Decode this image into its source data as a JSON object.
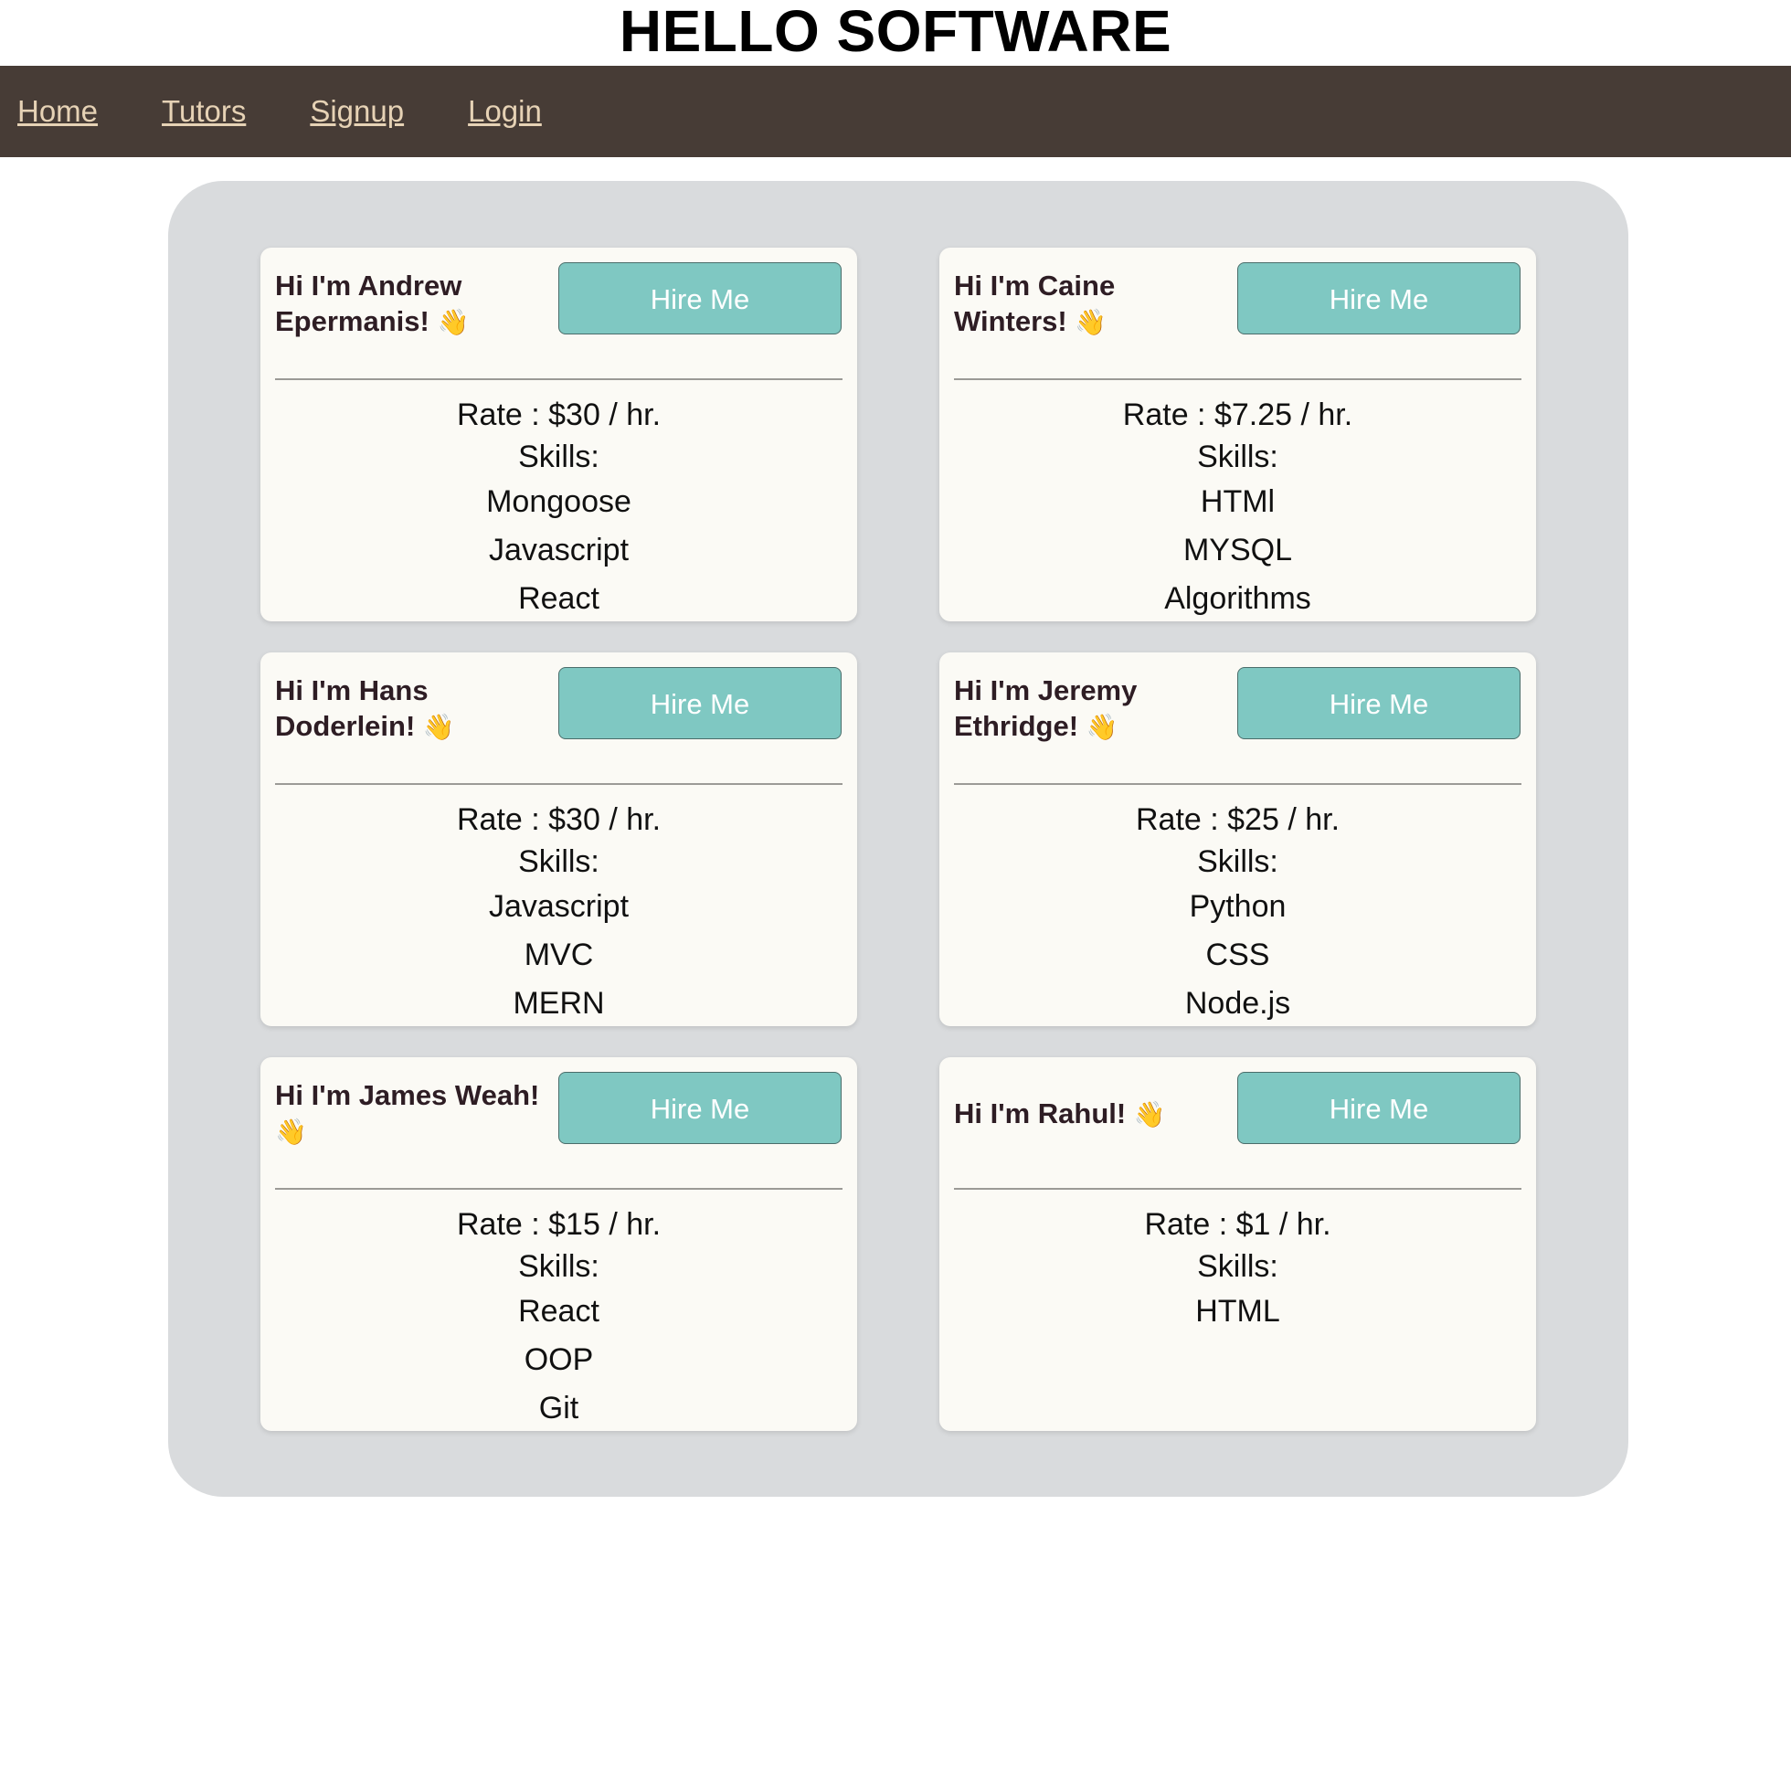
{
  "site": {
    "title": "HELLO SOFTWARE"
  },
  "nav": {
    "items": [
      {
        "label": "Home"
      },
      {
        "label": "Tutors"
      },
      {
        "label": "Signup"
      },
      {
        "label": "Login"
      }
    ]
  },
  "tutors": [
    {
      "name_line1": "Hi I'm Andrew",
      "name_line2": "Epermanis!",
      "wave": "👋",
      "button": "Hire Me",
      "rate": "Rate : $30 / hr.",
      "skills_label": "Skills:",
      "skills": [
        "Mongoose",
        "Javascript",
        "React"
      ]
    },
    {
      "name_line1": "Hi I'm Caine",
      "name_line2": "Winters!",
      "wave": "👋",
      "button": "Hire Me",
      "rate": "Rate : $7.25 / hr.",
      "skills_label": "Skills:",
      "skills": [
        "HTMl",
        "MYSQL",
        "Algorithms"
      ]
    },
    {
      "name_line1": "Hi I'm Hans",
      "name_line2": "Doderlein!",
      "wave": "👋",
      "button": "Hire Me",
      "rate": "Rate : $30 / hr.",
      "skills_label": "Skills:",
      "skills": [
        "Javascript",
        "MVC",
        "MERN"
      ]
    },
    {
      "name_line1": "Hi I'm Jeremy",
      "name_line2": "Ethridge!",
      "wave": "👋",
      "button": "Hire Me",
      "rate": "Rate : $25 / hr.",
      "skills_label": "Skills:",
      "skills": [
        "Python",
        "CSS",
        "Node.js"
      ]
    },
    {
      "name_line1": "Hi I'm James Weah!",
      "name_line2": "",
      "wave": "👋",
      "button": "Hire Me",
      "rate": "Rate : $15 / hr.",
      "skills_label": "Skills:",
      "skills": [
        "React",
        "OOP",
        "Git"
      ]
    },
    {
      "name_line1": "Hi I'm Rahul!",
      "name_line2": "",
      "wave": "👋",
      "button": "Hire Me",
      "rate": "Rate : $1 / hr.",
      "skills_label": "Skills:",
      "skills": [
        "HTML"
      ]
    }
  ],
  "colors": {
    "nav_bg": "#473c36",
    "nav_link": "#e6d2b5",
    "panel_bg": "#d9dbdd",
    "card_bg": "#fbfaf5",
    "button_bg": "#7fc8c2",
    "name_text": "#2e1d24"
  }
}
